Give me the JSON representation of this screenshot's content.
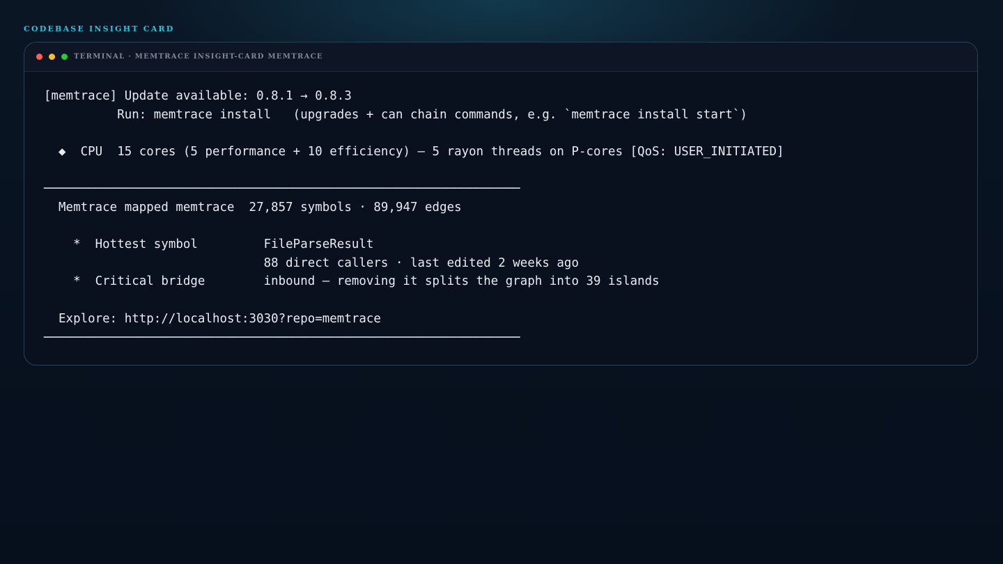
{
  "page_label": "CODEBASE INSIGHT CARD",
  "window": {
    "title": "TERMINAL · MEMTRACE INSIGHT-CARD MEMTRACE",
    "controls": [
      "close",
      "minimize",
      "zoom"
    ]
  },
  "terminal": {
    "lines": {
      "update": "[memtrace] Update available: 0.8.1 → 0.8.3",
      "run": "          Run: memtrace install   (upgrades + can chain commands, e.g. `memtrace install start`)",
      "cpu": "  ◆  CPU  15 cores (5 performance + 10 efficiency) — 5 rayon threads on P-cores [QoS: USER_INITIATED]",
      "rule_top": "─────────────────────────────────────────────────────────────────",
      "mapped": "  Memtrace mapped memtrace  27,857 symbols · 89,947 edges",
      "hottest": "    *  Hottest symbol         FileParseResult",
      "hottest_detail": "                              88 direct callers · last edited 2 weeks ago",
      "bridge": "    *  Critical bridge        inbound — removing it splits the graph into 39 islands",
      "explore": "  Explore: http://localhost:3030?repo=memtrace",
      "rule_bottom": "─────────────────────────────────────────────────────────────────"
    }
  },
  "colors": {
    "background": "#071120",
    "accent": "#27c3e3",
    "terminal_text": "#e8edf3",
    "window_border": "#29425a"
  }
}
